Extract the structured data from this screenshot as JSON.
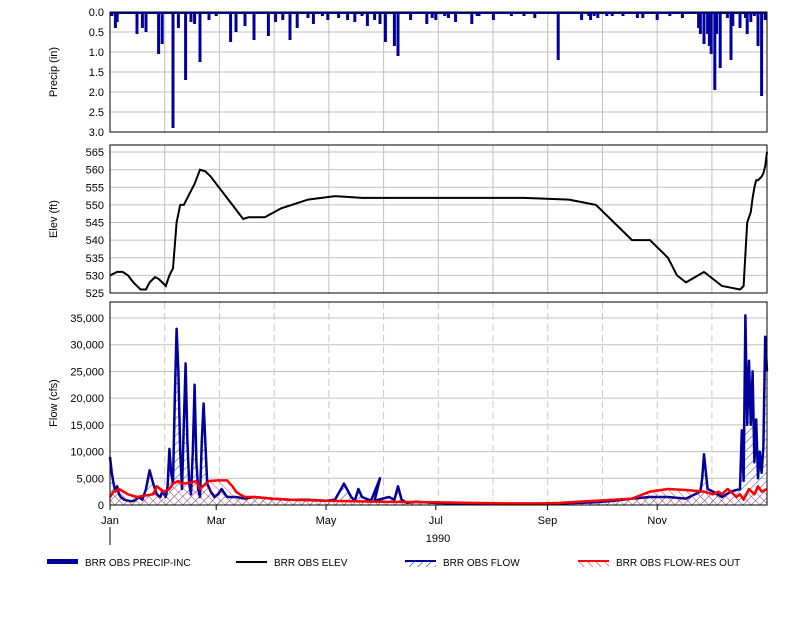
{
  "chart_data": [
    {
      "type": "bar",
      "panel": "precip",
      "ylabel": "Precip (in)",
      "ylim": [
        0,
        3
      ],
      "y_inverted": true,
      "y_ticks": [
        "0.0",
        "0.5",
        "1.0",
        "1.5",
        "2.0",
        "2.5",
        "3.0"
      ],
      "grid": true,
      "series": [
        {
          "name": "BRR OBS PRECIP-INC",
          "color": "#00009C",
          "x": [
            1,
            3,
            4,
            15,
            18,
            20,
            27,
            29,
            35,
            38,
            42,
            45,
            47,
            50,
            55,
            59,
            67,
            70,
            75,
            80,
            88,
            92,
            96,
            100,
            104,
            110,
            113,
            118,
            121,
            127,
            132,
            136,
            140,
            143,
            147,
            150,
            153,
            158,
            160,
            167,
            176,
            179,
            181,
            186,
            188,
            192,
            201,
            204,
            205,
            213,
            223,
            230,
            236,
            249,
            262,
            266,
            267,
            269,
            271,
            276,
            279,
            285,
            293,
            296,
            304,
            311,
            318,
            327,
            328,
            330,
            332,
            333,
            334,
            336,
            337,
            339,
            343,
            345,
            346,
            350,
            353,
            354,
            356,
            358,
            360,
            362,
            364
          ],
          "values": [
            0.1,
            0.4,
            0.25,
            0.55,
            0.4,
            0.5,
            1.05,
            0.8,
            2.9,
            0.4,
            1.7,
            0.25,
            0.3,
            1.25,
            0.2,
            0.1,
            0.75,
            0.5,
            0.35,
            0.7,
            0.6,
            0.25,
            0.2,
            0.7,
            0.4,
            0.15,
            0.3,
            0.1,
            0.2,
            0.15,
            0.2,
            0.25,
            0.1,
            0.35,
            0.2,
            0.3,
            0.75,
            0.85,
            1.1,
            0.2,
            0.3,
            0.15,
            0.2,
            0.1,
            0.15,
            0.25,
            0.3,
            0.1,
            0.1,
            0.2,
            0.1,
            0.1,
            0.15,
            1.2,
            0.2,
            0.1,
            0.2,
            0.1,
            0.15,
            0.1,
            0.1,
            0.1,
            0.15,
            0.15,
            0.2,
            0.1,
            0.15,
            0.4,
            0.55,
            0.8,
            0.55,
            0.85,
            1.05,
            1.95,
            0.55,
            1.4,
            0.15,
            1.2,
            0.35,
            0.4,
            0.15,
            0.55,
            0.25,
            0.1,
            0.85,
            2.1,
            0.2
          ]
        }
      ]
    },
    {
      "type": "line",
      "panel": "elev",
      "ylabel": "Elev (ft)",
      "ylim": [
        525,
        567
      ],
      "y_ticks": [
        "525",
        "530",
        "535",
        "540",
        "545",
        "550",
        "555",
        "560",
        "565"
      ],
      "grid": true,
      "series": [
        {
          "name": "BRR OBS ELEV",
          "color": "#000000",
          "x": [
            0,
            2,
            4,
            7,
            10,
            13,
            17,
            20,
            22,
            25,
            27,
            29,
            31,
            33,
            35,
            37,
            39,
            41,
            44,
            47,
            50,
            53,
            56,
            59,
            62,
            65,
            68,
            71,
            74,
            77,
            81,
            86,
            95,
            110,
            125,
            140,
            160,
            180,
            200,
            230,
            255,
            260,
            270,
            280,
            290,
            300,
            310,
            315,
            320,
            330,
            340,
            345,
            350,
            352,
            354,
            356,
            357,
            358,
            359,
            360,
            361,
            362,
            363,
            364,
            365
          ],
          "values": [
            530,
            530.5,
            531,
            531,
            530,
            528,
            526,
            526,
            528,
            529.5,
            529,
            528,
            527,
            530,
            532,
            545,
            550,
            550,
            553,
            556,
            560,
            559.5,
            558,
            556,
            554,
            552,
            550,
            548,
            546,
            546.5,
            546.5,
            546.5,
            549,
            551.5,
            552.5,
            552,
            552,
            552,
            552,
            552,
            551.5,
            551,
            550,
            545,
            540,
            540,
            535,
            530,
            528,
            531,
            527,
            526.5,
            526,
            527,
            545,
            548,
            552,
            555,
            557,
            557,
            557.5,
            558,
            559,
            561,
            565
          ]
        }
      ]
    },
    {
      "type": "line",
      "panel": "flow",
      "ylabel": "Flow (cfs)",
      "ylim": [
        0,
        38000
      ],
      "y_ticks": [
        "0",
        "5,000",
        "10,000",
        "15,000",
        "20,000",
        "25,000",
        "30,000",
        "35,000"
      ],
      "xlabel": "1990",
      "x_ticks": [
        "Jan",
        "Mar",
        "May",
        "Jul",
        "Sep",
        "Nov"
      ],
      "x_tick_days": [
        0,
        59,
        120,
        181,
        243,
        304
      ],
      "grid": true,
      "series": [
        {
          "name": "BRR OBS FLOW",
          "color": "#00009C",
          "x": [
            0,
            1,
            2,
            3,
            4,
            5,
            6,
            8,
            10,
            12,
            14,
            16,
            18,
            20,
            22,
            24,
            26,
            28,
            29,
            30,
            31,
            32,
            33,
            34,
            35,
            36,
            37,
            38,
            39,
            40,
            41,
            42,
            43,
            44,
            45,
            46,
            47,
            48,
            49,
            50,
            51,
            52,
            54,
            56,
            58,
            60,
            62,
            65,
            70,
            75,
            80,
            90,
            100,
            110,
            120,
            125,
            130,
            134,
            136,
            138,
            140,
            145,
            150,
            147,
            155,
            158,
            160,
            162,
            165,
            170,
            180,
            190,
            200,
            210,
            220,
            230,
            240,
            250,
            260,
            270,
            280,
            290,
            300,
            310,
            320,
            325,
            328,
            329,
            330,
            332,
            335,
            340,
            345,
            350,
            351,
            352,
            353,
            354,
            355,
            356,
            357,
            358,
            359,
            360,
            361,
            362,
            363,
            364,
            365
          ],
          "values": [
            9000,
            6000,
            4000,
            2500,
            3500,
            2000,
            1500,
            1000,
            800,
            700,
            900,
            1500,
            1000,
            3000,
            6500,
            4000,
            2000,
            1500,
            2500,
            2000,
            1500,
            3500,
            10500,
            6000,
            4000,
            20000,
            33000,
            25000,
            10000,
            3000,
            15000,
            26500,
            12000,
            4000,
            2000,
            10000,
            22500,
            8000,
            3000,
            1500,
            12000,
            19000,
            4000,
            2500,
            1500,
            2000,
            3000,
            1500,
            1500,
            1200,
            1500,
            1200,
            1000,
            1000,
            800,
            1000,
            4000,
            1500,
            800,
            3000,
            1500,
            800,
            5000,
            800,
            1500,
            1000,
            3500,
            1000,
            400,
            600,
            400,
            300,
            300,
            300,
            200,
            200,
            200,
            300,
            400,
            500,
            800,
            1200,
            1500,
            1500,
            1200,
            2000,
            2500,
            5000,
            9500,
            3000,
            2500,
            1500,
            2500,
            3000,
            14000,
            4500,
            35500,
            15000,
            27000,
            15000,
            25000,
            8000,
            16000,
            5000,
            10000,
            6000,
            11000,
            31500,
            25000
          ]
        },
        {
          "name": "BRR OBS FLOW-RES OUT",
          "color": "#FF0000",
          "x": [
            0,
            2,
            5,
            10,
            15,
            20,
            24,
            26,
            30,
            33,
            35,
            38,
            40,
            45,
            48,
            50,
            55,
            60,
            65,
            68,
            70,
            72,
            75,
            80,
            90,
            100,
            120,
            150,
            180,
            200,
            220,
            240,
            250,
            260,
            270,
            280,
            290,
            300,
            310,
            320,
            330,
            335,
            338,
            340,
            343,
            345,
            348,
            350,
            352,
            355,
            358,
            360,
            362,
            365
          ],
          "values": [
            1500,
            2500,
            3000,
            2000,
            1500,
            1800,
            2000,
            3500,
            2500,
            3000,
            4000,
            4500,
            4000,
            4200,
            4500,
            3000,
            4500,
            4600,
            4600,
            3500,
            2500,
            2000,
            1500,
            1500,
            1200,
            1000,
            800,
            600,
            500,
            400,
            300,
            300,
            400,
            600,
            800,
            1000,
            1200,
            2500,
            3000,
            2800,
            2500,
            2000,
            2500,
            2000,
            3000,
            2500,
            1500,
            2000,
            1000,
            3000,
            2000,
            3500,
            2500,
            3000
          ]
        }
      ]
    }
  ],
  "legend": [
    {
      "label": "BRR OBS PRECIP-INC",
      "style": "bar",
      "color": "#00009C"
    },
    {
      "label": "BRR OBS ELEV",
      "style": "line",
      "color": "#000000"
    },
    {
      "label": "BRR OBS FLOW",
      "style": "hatch-line",
      "color": "#00009C"
    },
    {
      "label": "BRR OBS FLOW-RES OUT",
      "style": "hatch-line",
      "color": "#FF0000"
    }
  ]
}
